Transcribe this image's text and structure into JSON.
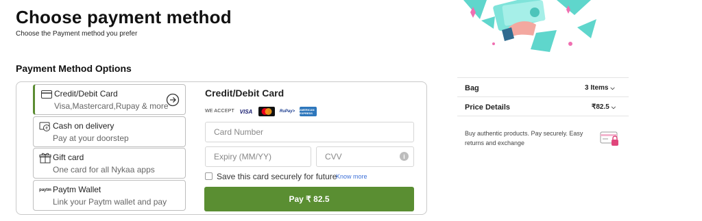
{
  "header": {
    "title": "Choose payment method",
    "subtitle": "Choose the Payment method you prefer"
  },
  "section_title": "Payment Method Options",
  "methods": [
    {
      "title": "Credit/Debit Card",
      "subtitle": "Visa,Mastercard,Rupay & more",
      "icon": "credit-card-icon",
      "active": true
    },
    {
      "title": "Cash on delivery",
      "subtitle": "Pay at your doorstep",
      "icon": "cash-icon",
      "active": false
    },
    {
      "title": "Gift card",
      "subtitle": "One card for all Nykaa apps",
      "icon": "gift-icon",
      "active": false
    },
    {
      "title": "Paytm Wallet",
      "subtitle": "Link your Paytm wallet and pay",
      "icon": "paytm-icon",
      "icon_text": "paytm",
      "active": false
    }
  ],
  "card_form": {
    "title": "Credit/Debit Card",
    "we_accept": "WE ACCEPT",
    "logos": {
      "visa": "VISA",
      "rupay": "RuPay>",
      "amex": "AMERICAN EXPRESS"
    },
    "card_number_placeholder": "Card Number",
    "expiry_placeholder": "Expiry (MM/YY)",
    "cvv_placeholder": "CVV",
    "cvv_info": "i",
    "save_label": "Save this card securely for future",
    "know_more": "Know more",
    "pay_button": "Pay ₹ 82.5"
  },
  "summary": {
    "bag_label": "Bag",
    "bag_value": "3 Items",
    "price_label": "Price Details",
    "price_value": "₹82.5",
    "trust_text": "Buy authentic products. Pay securely. Easy returns and exchange"
  },
  "colors": {
    "accent_green": "#5a8e32",
    "link_blue": "#3b6fd8",
    "illustration_teal": "#5fd6cc",
    "illustration_pink": "#f06fb1"
  }
}
